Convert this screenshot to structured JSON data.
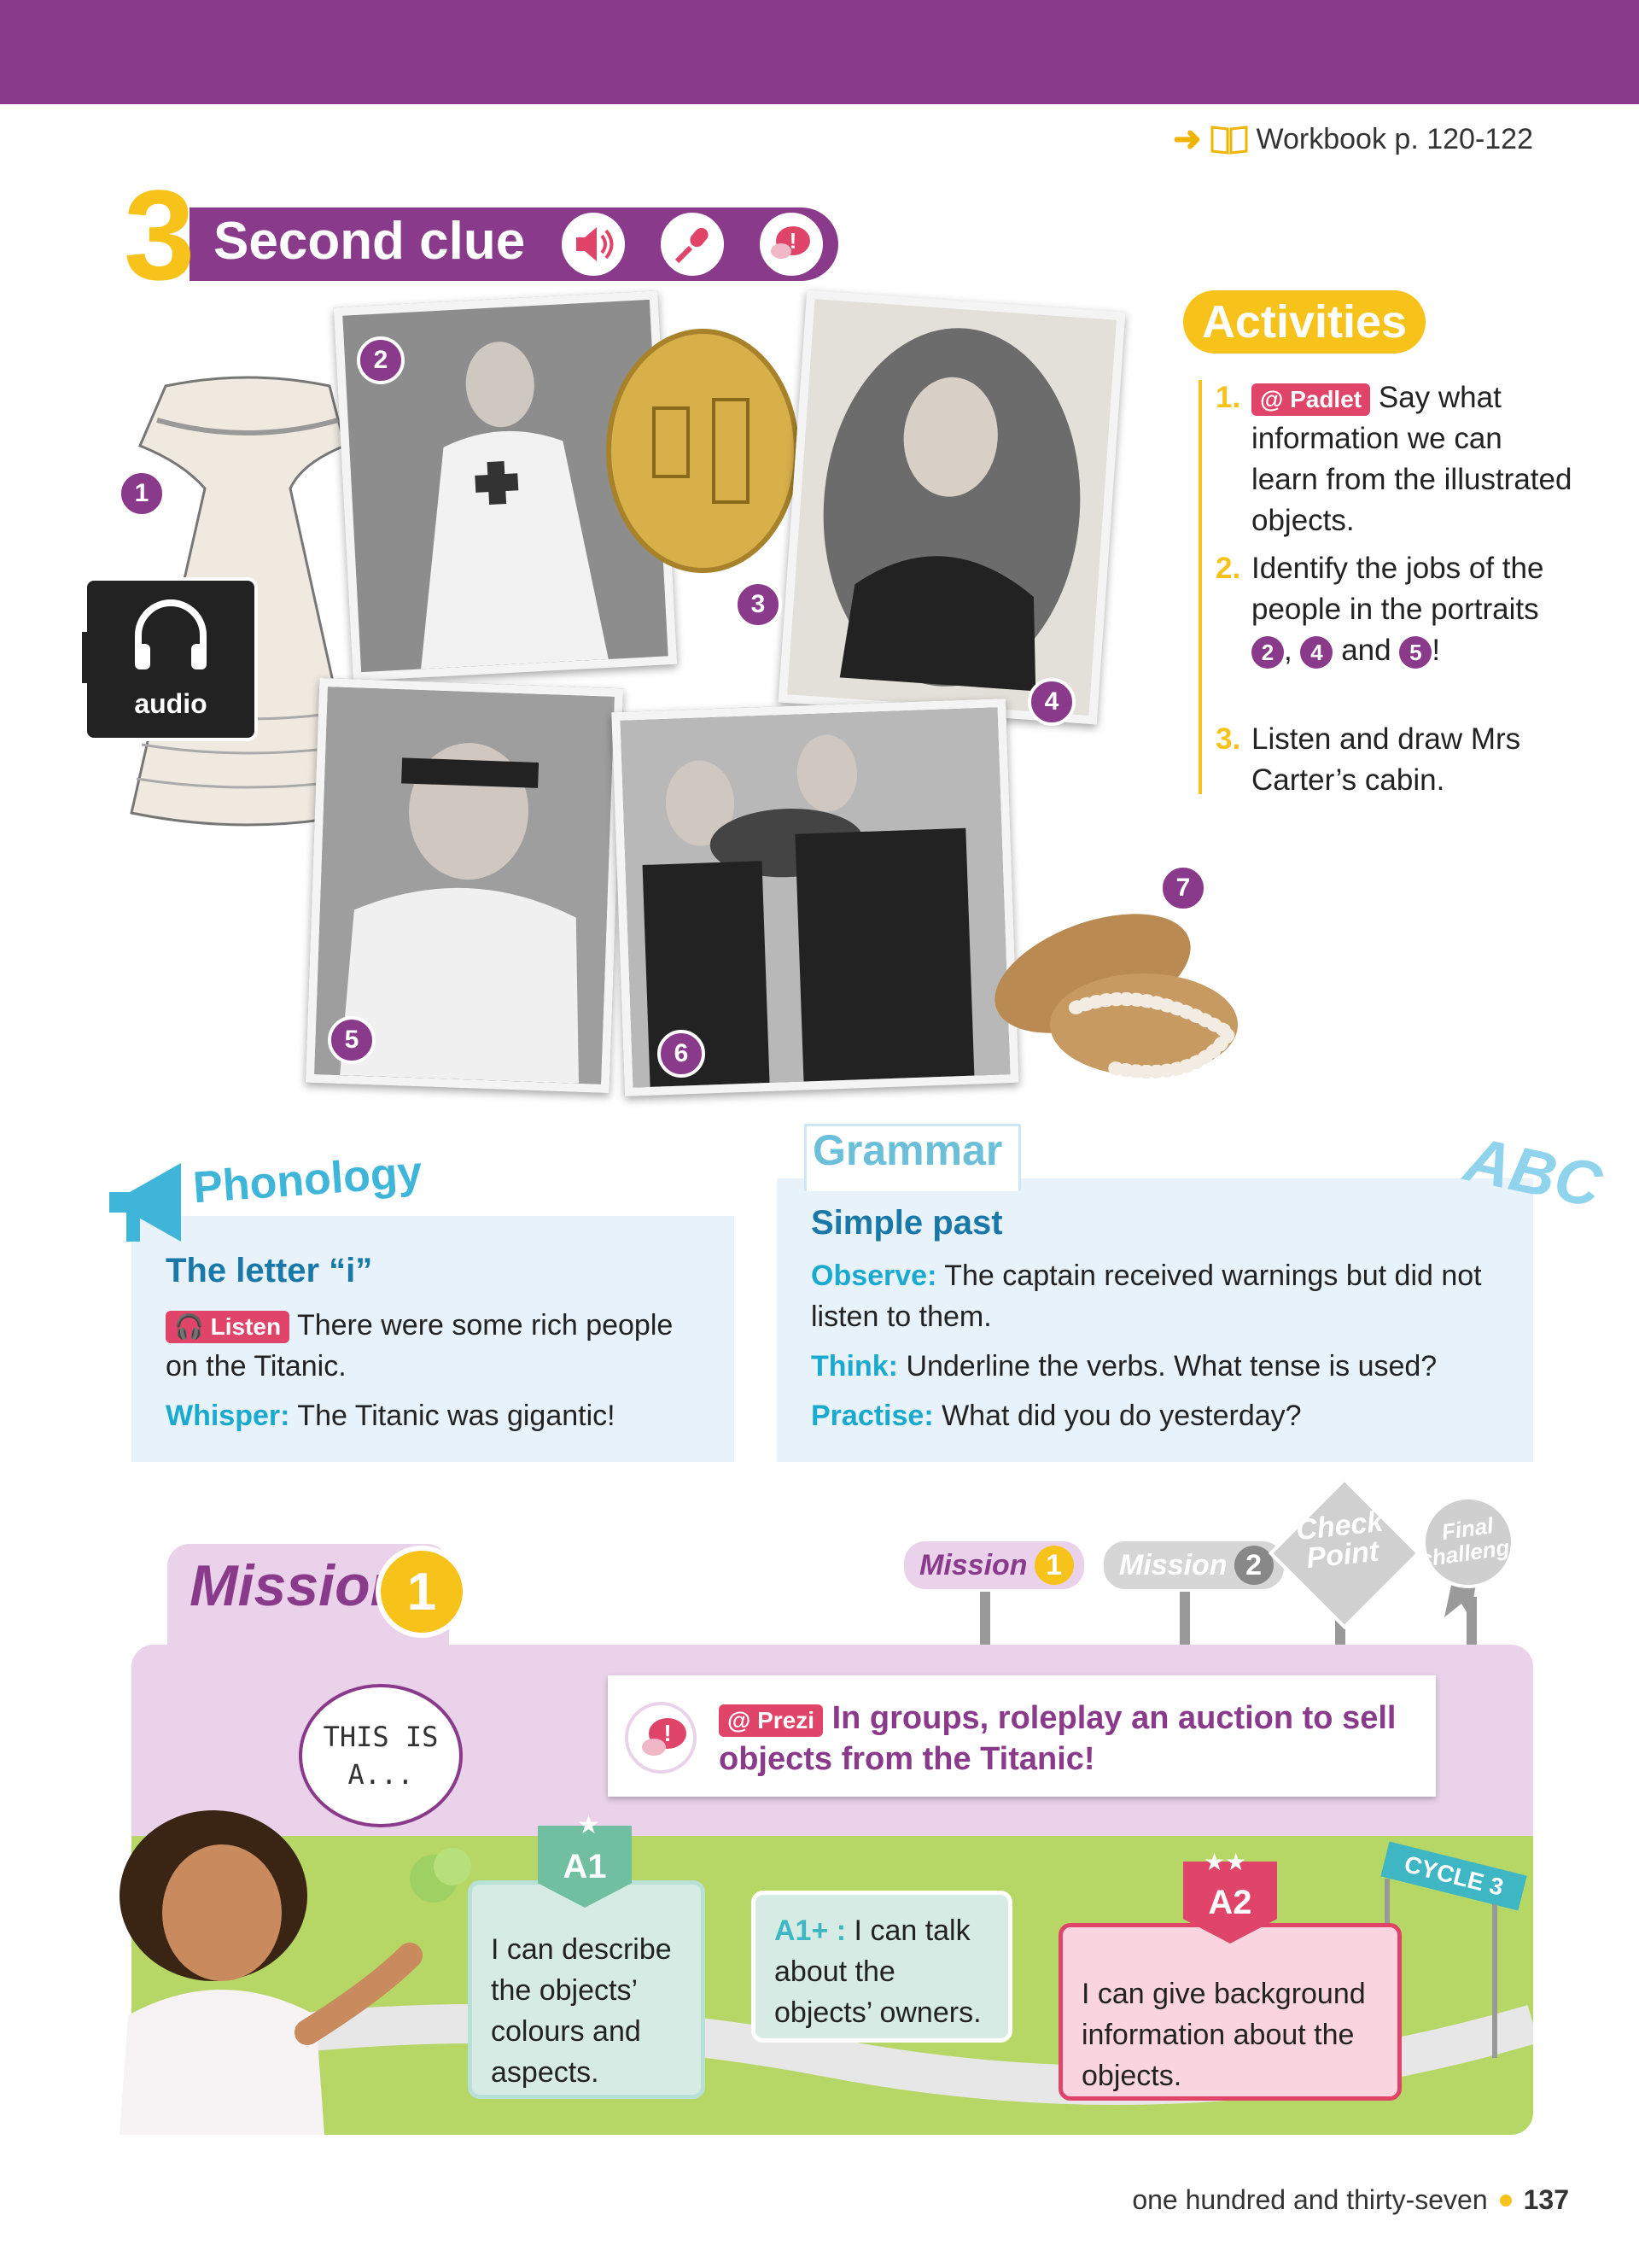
{
  "workbook": {
    "text": "Workbook p. 120-122"
  },
  "section": {
    "number": "3",
    "title": "Second clue"
  },
  "photos": {
    "badges": [
      "1",
      "2",
      "3",
      "4",
      "5",
      "6",
      "7"
    ],
    "audio_label": "audio"
  },
  "activities": {
    "title": "Activities",
    "items": [
      {
        "num": "1.",
        "tag": "@ Padlet",
        "text": "Say what information we can learn from the illustrated objects."
      },
      {
        "num": "2.",
        "text_a": "Identify the jobs of the people in the portraits",
        "refs": [
          "2",
          "4",
          "5"
        ],
        "sep": ",",
        "and": "and",
        "end": "!"
      },
      {
        "num": "3.",
        "text": "Listen and draw Mrs Carter’s cabin."
      }
    ]
  },
  "phonology": {
    "title": "Phonology",
    "heading": "The letter “i”",
    "listen_tag": "Listen",
    "listen_text": "There were some rich people on the Titanic.",
    "whisper_label": "Whisper:",
    "whisper_text": "The Titanic was gigantic!"
  },
  "grammar": {
    "title": "Grammar",
    "abc": "ABC",
    "heading": "Simple past",
    "observe_label": "Observe:",
    "observe_text": "The captain received warnings but did not listen to them.",
    "think_label": "Think:",
    "think_text": "Underline the verbs. What tense is used?",
    "practise_label": "Practise:",
    "practise_text": "What did you do yesterday?"
  },
  "mission": {
    "title": "Mission",
    "number": "1",
    "signs": [
      {
        "label": "Mission",
        "num": "1"
      },
      {
        "label": "Mission",
        "num": "2"
      },
      {
        "label": "Check Point"
      },
      {
        "label": "Final challenge"
      }
    ],
    "speech": "THIS IS A...",
    "task_tag": "@ Prezi",
    "task_text": "In groups, roleplay an auction to sell objects from the Titanic!",
    "cycle": "CYCLE 3",
    "levels": [
      {
        "badge": "A1",
        "text": "I can describe the objects’ colours and aspects."
      },
      {
        "badge": "A1+ :",
        "text": "I can talk about the objects’ owners."
      },
      {
        "badge": "A2",
        "text": "I can give background information about the objects."
      }
    ]
  },
  "footer": {
    "words": "one hundred and thirty-seven",
    "page": "137"
  },
  "colors": {
    "purple": "#8a3a8a",
    "yellow": "#f7c21a",
    "blue": "#1aa9cf",
    "pink": "#e04468"
  }
}
